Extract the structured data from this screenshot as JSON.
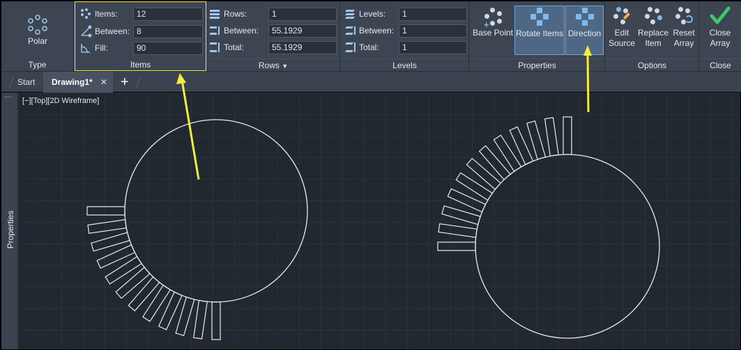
{
  "ribbon": {
    "type_panel": {
      "button": "Polar",
      "title": "Type"
    },
    "items_panel": {
      "title": "Items",
      "rows": [
        {
          "label": "Items:",
          "value": "12"
        },
        {
          "label": "Between:",
          "value": "8"
        },
        {
          "label": "Fill:",
          "value": "90"
        }
      ]
    },
    "rows_panel": {
      "title": "Rows",
      "rows": [
        {
          "label": "Rows:",
          "value": "1"
        },
        {
          "label": "Between:",
          "value": "55.1929"
        },
        {
          "label": "Total:",
          "value": "55.1929"
        }
      ]
    },
    "levels_panel": {
      "title": "Levels",
      "rows": [
        {
          "label": "Levels:",
          "value": "1"
        },
        {
          "label": "Between:",
          "value": "1"
        },
        {
          "label": "Total:",
          "value": "1"
        }
      ]
    },
    "properties_panel": {
      "title": "Properties",
      "base_point": "Base Point",
      "rotate_items": "Rotate Items",
      "direction": "Direction"
    },
    "options_panel": {
      "title": "Options",
      "edit_source": [
        "Edit",
        "Source"
      ],
      "replace_item": [
        "Replace",
        "Item"
      ],
      "reset_array": [
        "Reset",
        "Array"
      ]
    },
    "close_panel": {
      "title": "Close",
      "close_array": [
        "Close",
        "Array"
      ]
    }
  },
  "tabs": {
    "start": "Start",
    "drawing": "Drawing1*"
  },
  "viewport": {
    "label": "[−][Top][2D Wireframe]"
  },
  "sidebar": {
    "label": "Properties"
  },
  "colors": {
    "accent": "#7fb8ee",
    "highlight": "#f5ef3c",
    "canvas": "#212830"
  }
}
